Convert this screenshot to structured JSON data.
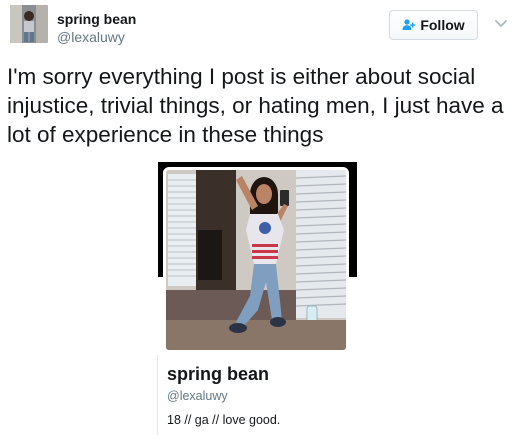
{
  "header": {
    "display_name": "spring bean",
    "handle": "@lexaluwy",
    "follow_label": "Follow"
  },
  "tweet": {
    "text": "I'm sorry everything I post is either about social injustice, trivial things, or hating men, I just have a lot of experience in these things"
  },
  "embedded_profile_card": {
    "name": "spring bean",
    "handle": "@lexaluwy",
    "bio": "18 // ga // love good."
  },
  "icons": {
    "follow": "add-user-icon",
    "menu": "chevron-down-icon",
    "photo": "profile-photo"
  },
  "colors": {
    "accent": "#1da1f2",
    "secondary_text": "#657786",
    "text": "#14171a",
    "border": "#e1e8ed"
  }
}
